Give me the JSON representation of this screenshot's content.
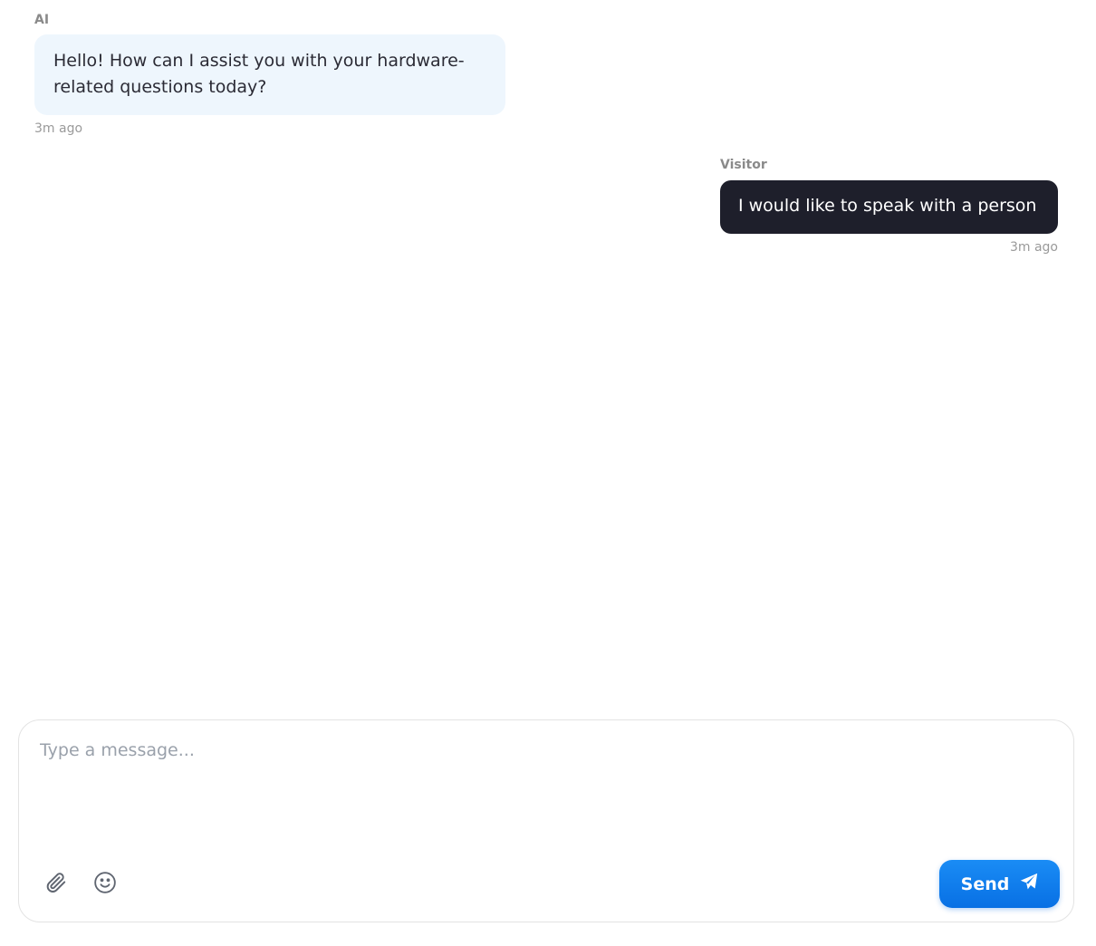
{
  "messages": [
    {
      "sender": "AI",
      "text": "Hello! How can I assist you with your hardware-related questions today?",
      "time": "3m ago"
    },
    {
      "sender": "Visitor",
      "text": "I would like to speak with a person",
      "time": "3m ago"
    }
  ],
  "composer": {
    "placeholder": "Type a message...",
    "value": "",
    "attach_icon": "paperclip-icon",
    "emoji_icon": "smiley-icon",
    "send_label": "Send",
    "send_icon": "paper-plane-icon"
  },
  "colors": {
    "ai_bubble": "#eef6fd",
    "visitor_bubble": "#1e1f2b",
    "send_button": "#0a78eb"
  }
}
